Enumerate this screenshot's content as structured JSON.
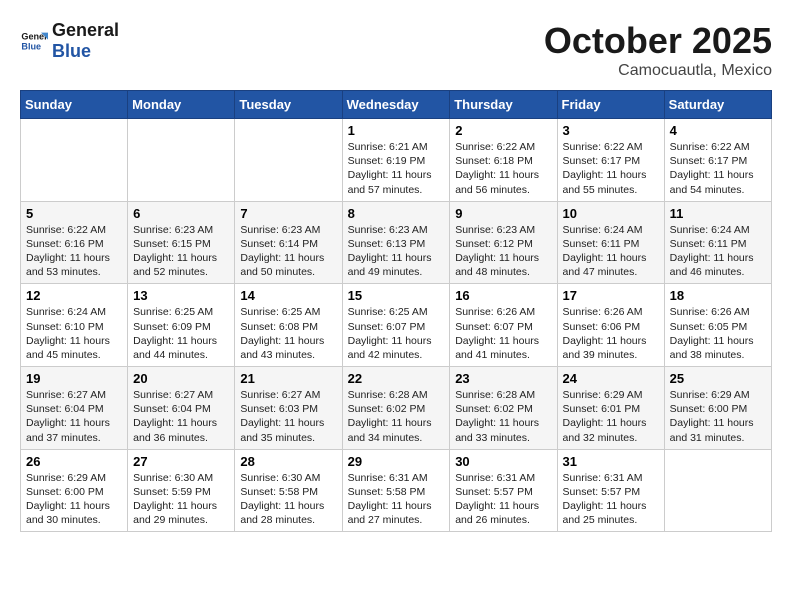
{
  "header": {
    "logo_line1": "General",
    "logo_line2": "Blue",
    "month": "October 2025",
    "location": "Camocuautla, Mexico"
  },
  "weekdays": [
    "Sunday",
    "Monday",
    "Tuesday",
    "Wednesday",
    "Thursday",
    "Friday",
    "Saturday"
  ],
  "weeks": [
    [
      {
        "day": "",
        "info": ""
      },
      {
        "day": "",
        "info": ""
      },
      {
        "day": "",
        "info": ""
      },
      {
        "day": "1",
        "info": "Sunrise: 6:21 AM\nSunset: 6:19 PM\nDaylight: 11 hours\nand 57 minutes."
      },
      {
        "day": "2",
        "info": "Sunrise: 6:22 AM\nSunset: 6:18 PM\nDaylight: 11 hours\nand 56 minutes."
      },
      {
        "day": "3",
        "info": "Sunrise: 6:22 AM\nSunset: 6:17 PM\nDaylight: 11 hours\nand 55 minutes."
      },
      {
        "day": "4",
        "info": "Sunrise: 6:22 AM\nSunset: 6:17 PM\nDaylight: 11 hours\nand 54 minutes."
      }
    ],
    [
      {
        "day": "5",
        "info": "Sunrise: 6:22 AM\nSunset: 6:16 PM\nDaylight: 11 hours\nand 53 minutes."
      },
      {
        "day": "6",
        "info": "Sunrise: 6:23 AM\nSunset: 6:15 PM\nDaylight: 11 hours\nand 52 minutes."
      },
      {
        "day": "7",
        "info": "Sunrise: 6:23 AM\nSunset: 6:14 PM\nDaylight: 11 hours\nand 50 minutes."
      },
      {
        "day": "8",
        "info": "Sunrise: 6:23 AM\nSunset: 6:13 PM\nDaylight: 11 hours\nand 49 minutes."
      },
      {
        "day": "9",
        "info": "Sunrise: 6:23 AM\nSunset: 6:12 PM\nDaylight: 11 hours\nand 48 minutes."
      },
      {
        "day": "10",
        "info": "Sunrise: 6:24 AM\nSunset: 6:11 PM\nDaylight: 11 hours\nand 47 minutes."
      },
      {
        "day": "11",
        "info": "Sunrise: 6:24 AM\nSunset: 6:11 PM\nDaylight: 11 hours\nand 46 minutes."
      }
    ],
    [
      {
        "day": "12",
        "info": "Sunrise: 6:24 AM\nSunset: 6:10 PM\nDaylight: 11 hours\nand 45 minutes."
      },
      {
        "day": "13",
        "info": "Sunrise: 6:25 AM\nSunset: 6:09 PM\nDaylight: 11 hours\nand 44 minutes."
      },
      {
        "day": "14",
        "info": "Sunrise: 6:25 AM\nSunset: 6:08 PM\nDaylight: 11 hours\nand 43 minutes."
      },
      {
        "day": "15",
        "info": "Sunrise: 6:25 AM\nSunset: 6:07 PM\nDaylight: 11 hours\nand 42 minutes."
      },
      {
        "day": "16",
        "info": "Sunrise: 6:26 AM\nSunset: 6:07 PM\nDaylight: 11 hours\nand 41 minutes."
      },
      {
        "day": "17",
        "info": "Sunrise: 6:26 AM\nSunset: 6:06 PM\nDaylight: 11 hours\nand 39 minutes."
      },
      {
        "day": "18",
        "info": "Sunrise: 6:26 AM\nSunset: 6:05 PM\nDaylight: 11 hours\nand 38 minutes."
      }
    ],
    [
      {
        "day": "19",
        "info": "Sunrise: 6:27 AM\nSunset: 6:04 PM\nDaylight: 11 hours\nand 37 minutes."
      },
      {
        "day": "20",
        "info": "Sunrise: 6:27 AM\nSunset: 6:04 PM\nDaylight: 11 hours\nand 36 minutes."
      },
      {
        "day": "21",
        "info": "Sunrise: 6:27 AM\nSunset: 6:03 PM\nDaylight: 11 hours\nand 35 minutes."
      },
      {
        "day": "22",
        "info": "Sunrise: 6:28 AM\nSunset: 6:02 PM\nDaylight: 11 hours\nand 34 minutes."
      },
      {
        "day": "23",
        "info": "Sunrise: 6:28 AM\nSunset: 6:02 PM\nDaylight: 11 hours\nand 33 minutes."
      },
      {
        "day": "24",
        "info": "Sunrise: 6:29 AM\nSunset: 6:01 PM\nDaylight: 11 hours\nand 32 minutes."
      },
      {
        "day": "25",
        "info": "Sunrise: 6:29 AM\nSunset: 6:00 PM\nDaylight: 11 hours\nand 31 minutes."
      }
    ],
    [
      {
        "day": "26",
        "info": "Sunrise: 6:29 AM\nSunset: 6:00 PM\nDaylight: 11 hours\nand 30 minutes."
      },
      {
        "day": "27",
        "info": "Sunrise: 6:30 AM\nSunset: 5:59 PM\nDaylight: 11 hours\nand 29 minutes."
      },
      {
        "day": "28",
        "info": "Sunrise: 6:30 AM\nSunset: 5:58 PM\nDaylight: 11 hours\nand 28 minutes."
      },
      {
        "day": "29",
        "info": "Sunrise: 6:31 AM\nSunset: 5:58 PM\nDaylight: 11 hours\nand 27 minutes."
      },
      {
        "day": "30",
        "info": "Sunrise: 6:31 AM\nSunset: 5:57 PM\nDaylight: 11 hours\nand 26 minutes."
      },
      {
        "day": "31",
        "info": "Sunrise: 6:31 AM\nSunset: 5:57 PM\nDaylight: 11 hours\nand 25 minutes."
      },
      {
        "day": "",
        "info": ""
      }
    ]
  ]
}
